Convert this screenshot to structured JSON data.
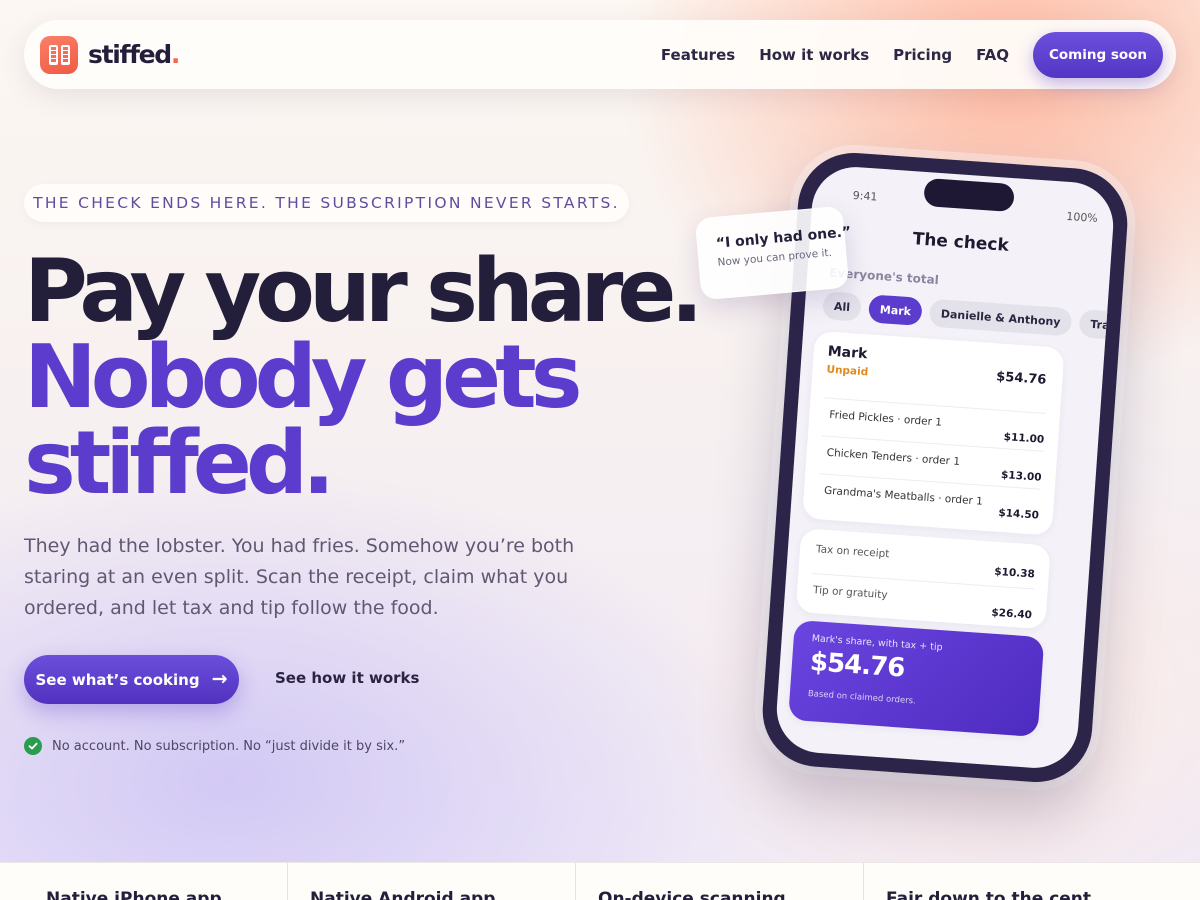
{
  "brand": {
    "name": "stiffed",
    "dot": ".",
    "logo_icon": "receipt-icon",
    "accent": "#5b3ccc",
    "logo_color": "#f06a50"
  },
  "nav": {
    "links": [
      "Features",
      "How it works",
      "Pricing",
      "FAQ"
    ],
    "cta": "Coming soon"
  },
  "hero": {
    "eyebrow": "THE CHECK ENDS HERE. THE SUBSCRIPTION NEVER STARTS.",
    "headline_1": "Pay your share.",
    "headline_2": "Nobody gets",
    "headline_3": "stiffed.",
    "lede": "They had the lobster. You had fries. Somehow you’re both staring at an even split. Scan the receipt, claim what you ordered, and let tax and tip follow the food.",
    "primary_cta": "See what’s cooking",
    "primary_cta_icon": "arrow-right-icon",
    "secondary_cta": "See how it works",
    "assurance": "No account. No subscription. No “just divide it by six.”",
    "assurance_icon": "check-circle-icon",
    "assurance_color": "#2a9d4c"
  },
  "bubble": {
    "quote": "“I only had one.”",
    "sub": "Now you can prove it."
  },
  "phone": {
    "time": "9:41",
    "battery": "100%",
    "title": "The check",
    "back_icon": "chevron-left-icon",
    "subtitle": "Everyone's total",
    "chips": [
      "All",
      "Mark",
      "Danielle & Anthony",
      "Tra"
    ],
    "active_chip": "Mark",
    "person": {
      "name": "Mark",
      "status": "Unpaid",
      "total": "$54.76",
      "status_color": "#e08a1e"
    },
    "items": [
      {
        "name": "Fried Pickles · order 1",
        "amount": "$11.00"
      },
      {
        "name": "Chicken Tenders · order 1",
        "amount": "$13.00"
      },
      {
        "name": "Grandma's Meatballs · order 1",
        "amount": "$14.50"
      }
    ],
    "extras": [
      {
        "name": "Tax on receipt",
        "amount": "$10.38"
      },
      {
        "name": "Tip or gratuity",
        "amount": "$26.40"
      }
    ],
    "share": {
      "label": "Mark's share, with tax + tip",
      "amount": "$54.76",
      "note": "Based on claimed orders."
    }
  },
  "features": [
    "Native iPhone app",
    "Native Android app",
    "On-device scanning",
    "Fair down to the cent"
  ]
}
